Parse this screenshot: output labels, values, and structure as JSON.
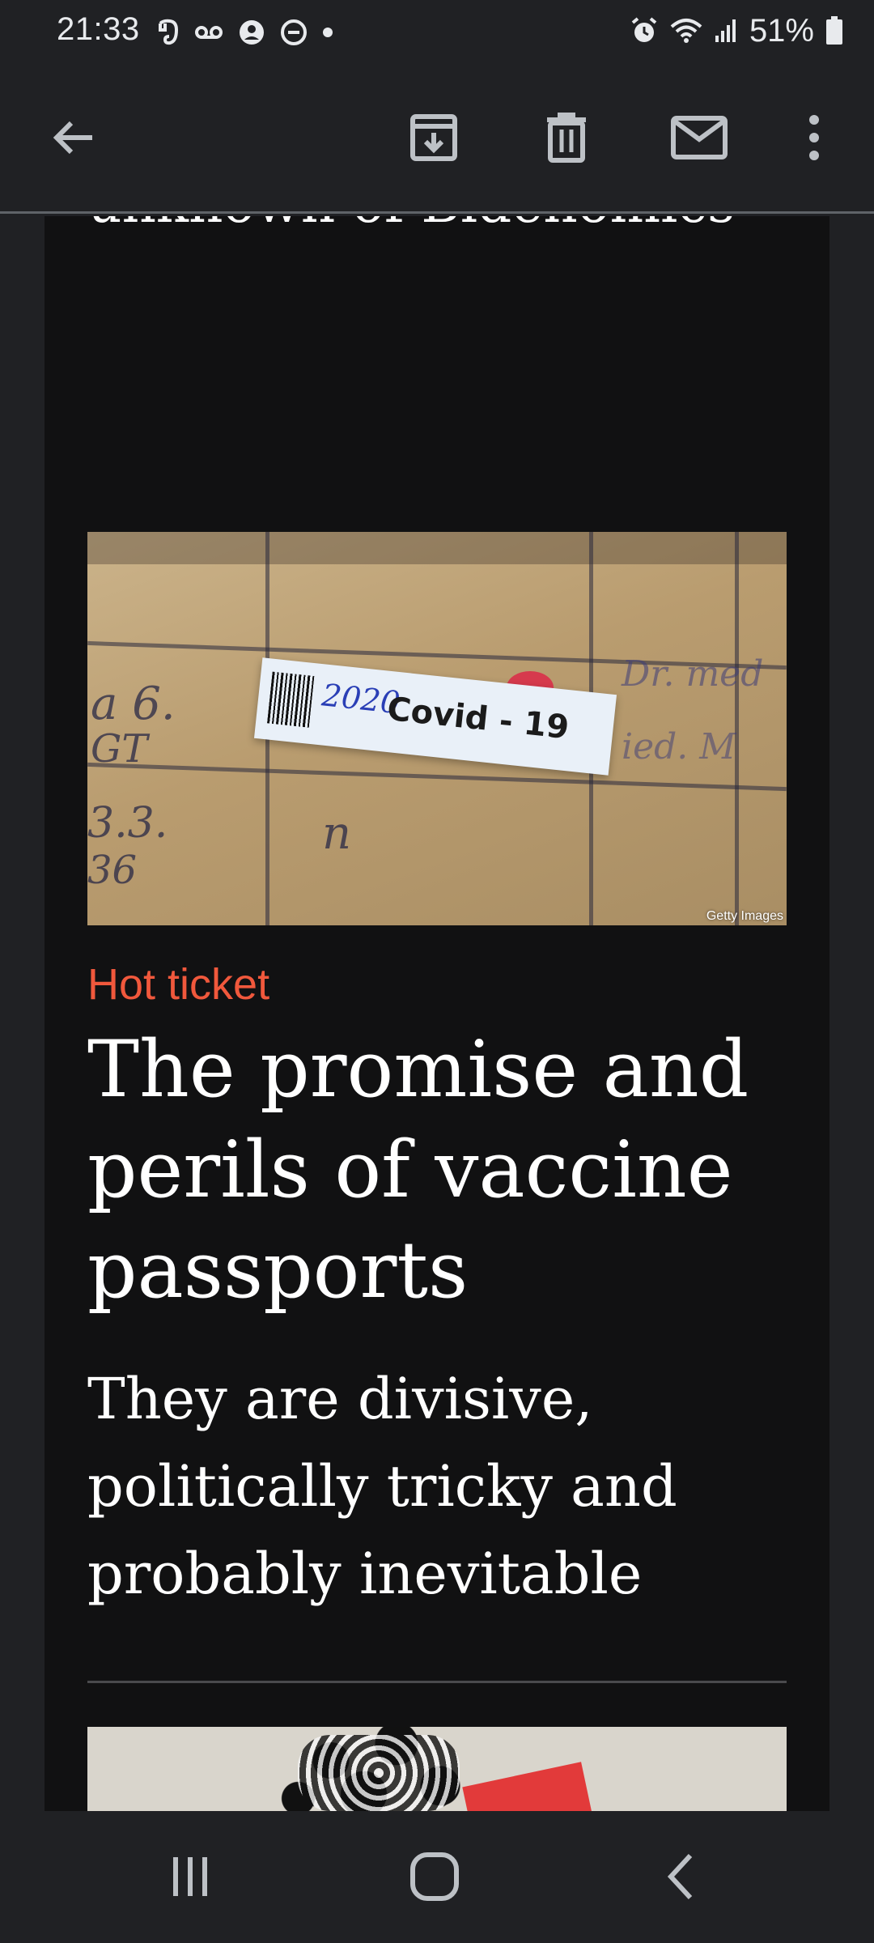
{
  "status_bar": {
    "time": "21:33",
    "battery_percent": "51%",
    "left_icons": [
      "evernote-icon",
      "voicemail-icon",
      "account-icon",
      "do-not-disturb-icon",
      "notification-dot-icon"
    ],
    "right_icons": [
      "alarm-icon",
      "wifi-icon",
      "signal-icon",
      "battery-icon"
    ]
  },
  "app_bar": {
    "icons": [
      "back-arrow-icon",
      "archive-icon",
      "delete-icon",
      "mark-unread-icon",
      "more-options-icon"
    ]
  },
  "email": {
    "previous_headline": "unknown of Bidenomics",
    "hero_image": {
      "credit": "Getty Images",
      "label_text": "Covid - 19",
      "label_year": "2020"
    },
    "kicker": "Hot ticket",
    "headline": "The promise and perils of vaccine passports",
    "standfirst": "They are divisive, politically tricky and probably inevitable"
  },
  "nav_bar": {
    "icons": [
      "recents-icon",
      "home-icon",
      "back-icon"
    ]
  },
  "colors": {
    "background": "#202124",
    "content_background": "#111112",
    "kicker": "#f0583c",
    "text": "#ffffff"
  }
}
